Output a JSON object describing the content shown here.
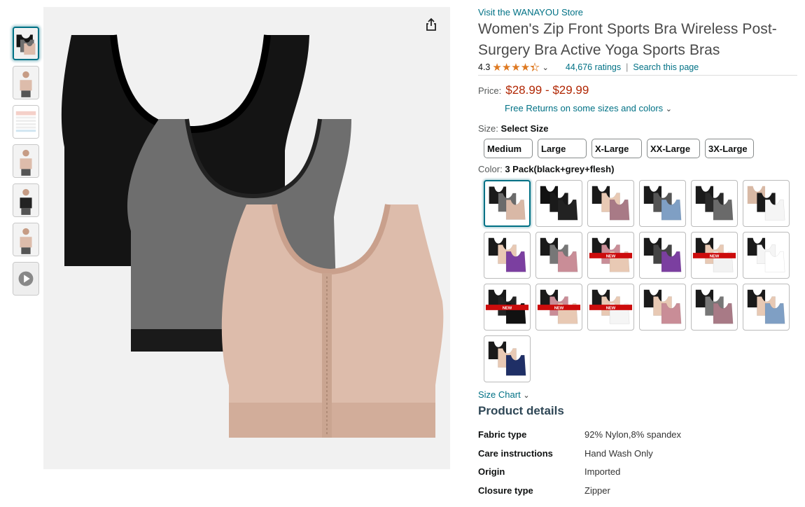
{
  "thumbnails": [
    {
      "name": "thumb-3pack",
      "icon": "bra-set"
    },
    {
      "name": "thumb-model-front",
      "icon": "model"
    },
    {
      "name": "thumb-size-chart",
      "icon": "chart"
    },
    {
      "name": "thumb-model-black",
      "icon": "model"
    },
    {
      "name": "thumb-model-back",
      "icon": "model"
    },
    {
      "name": "thumb-model-flesh",
      "icon": "model"
    },
    {
      "name": "thumb-video",
      "icon": "play"
    }
  ],
  "product": {
    "store_link": "Visit the WANAYOU Store",
    "title": "Women's Zip Front Sports Bra Wireless Post-Surgery Bra Active Yoga Sports Bras",
    "rating_value": "4.3",
    "ratings_count": "44,676 ratings",
    "search_page": "Search this page",
    "price_label": "Price:",
    "price": "$28.99 - $29.99",
    "returns": "Free Returns on some sizes and colors",
    "size_label": "Size:",
    "size_value": "Select Size",
    "sizes": [
      "Medium",
      "Large",
      "X-Large",
      "XX-Large",
      "3X-Large"
    ],
    "color_label": "Color:",
    "color_value": "3 Pack(black+grey+flesh)",
    "size_chart": "Size Chart",
    "details_title": "Product details",
    "details": [
      {
        "key": "Fabric type",
        "value": "92% Nylon,8% spandex"
      },
      {
        "key": "Care instructions",
        "value": "Hand Wash Only"
      },
      {
        "key": "Origin",
        "value": "Imported"
      },
      {
        "key": "Closure type",
        "value": "Zipper"
      }
    ]
  },
  "swatches": [
    {
      "colors": [
        "#1a1a1a",
        "#6b6b6b",
        "#d9b8a6"
      ],
      "label": ""
    },
    {
      "colors": [
        "#111111",
        "#1a1a1a",
        "#222222"
      ],
      "label": ""
    },
    {
      "colors": [
        "#1a1a1a",
        "#e8c9b4",
        "#a87a86"
      ],
      "label": ""
    },
    {
      "colors": [
        "#1a1a1a",
        "#555555",
        "#7f9fc4"
      ],
      "label": ""
    },
    {
      "colors": [
        "#1a1a1a",
        "#2a2a2a",
        "#6a6a6a"
      ],
      "label": ""
    },
    {
      "colors": [
        "#d8b9a5",
        "#1a1a1a",
        "#f5f5f5"
      ],
      "label": ""
    },
    {
      "colors": [
        "#1a1a1a",
        "#e8c9b4",
        "#7b3fa0"
      ],
      "label": ""
    },
    {
      "colors": [
        "#1a1a1a",
        "#777777",
        "#c98d97"
      ],
      "label": ""
    },
    {
      "colors": [
        "#1a1a1a",
        "#c98d97",
        "#e8c9b4"
      ],
      "label": "NEW"
    },
    {
      "colors": [
        "#1a1a1a",
        "#444444",
        "#7b3fa0"
      ],
      "label": ""
    },
    {
      "colors": [
        "#1a1a1a",
        "#e8c9b4",
        "#f2f2f2"
      ],
      "label": "NEW"
    },
    {
      "colors": [
        "#1a1a1a",
        "#f5f5f5",
        "#ffffff"
      ],
      "label": ""
    },
    {
      "colors": [
        "#1a1a1a",
        "#222222",
        "#111111"
      ],
      "label": "NEW"
    },
    {
      "colors": [
        "#1a1a1a",
        "#c98d97",
        "#e8c9b4"
      ],
      "label": "NEW"
    },
    {
      "colors": [
        "#1a1a1a",
        "#e8c9b4",
        "#f5f5f5"
      ],
      "label": "NEW"
    },
    {
      "colors": [
        "#1a1a1a",
        "#e8c9b4",
        "#c98d97"
      ],
      "label": ""
    },
    {
      "colors": [
        "#1a1a1a",
        "#777777",
        "#a87a86"
      ],
      "label": ""
    },
    {
      "colors": [
        "#1a1a1a",
        "#e8c9b4",
        "#7f9fc4"
      ],
      "label": ""
    },
    {
      "colors": [
        "#1a1a1a",
        "#e8c9b4",
        "#1f2f66"
      ],
      "label": ""
    }
  ],
  "colors": {
    "link": "#007185",
    "price": "#b12704",
    "star": "#de7921",
    "black_bra": "#141414",
    "grey_bra": "#6e6e6e",
    "flesh_bra": "#ddbcab"
  }
}
